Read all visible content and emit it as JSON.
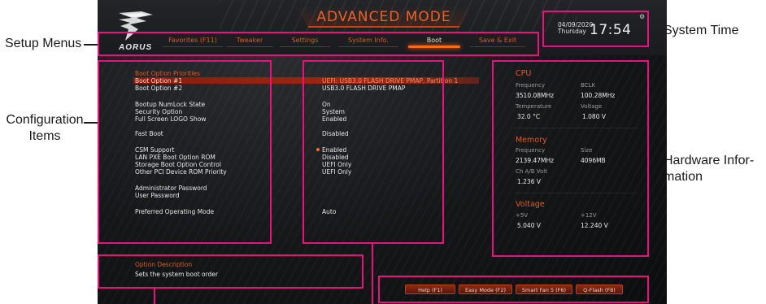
{
  "callouts": {
    "setup_menus": "Setup Menus",
    "configuration_items_line1": "Configuration",
    "configuration_items_line2": "Items",
    "system_time": "System Time",
    "hardware_info_line1": "Hardware Infor-",
    "hardware_info_line2": "mation"
  },
  "header": {
    "title": "ADVANCED MODE",
    "logo_text": "AORUS",
    "logo_icon": "eagle-logo-icon"
  },
  "clock": {
    "date": "04/09/2020",
    "day": "Thursday",
    "time": "17:54",
    "settings_icon": "gear-icon"
  },
  "tabs": [
    {
      "label": "Favorites (F11)",
      "active": false
    },
    {
      "label": "Tweaker",
      "active": false
    },
    {
      "label": "Settings",
      "active": false
    },
    {
      "label": "System Info.",
      "active": false
    },
    {
      "label": "Boot",
      "active": true
    },
    {
      "label": "Save & Exit",
      "active": false
    }
  ],
  "config": {
    "heading": "Boot Option Priorities",
    "items": [
      {
        "label": "Boot Option #1",
        "value": "UEFI: USB3.0 FLASH DRIVE PMAP, Partition 1"
      },
      {
        "label": "Boot Option #2",
        "value": "USB3.0 FLASH DRIVE PMAP"
      },
      {
        "label": "Bootup NumLock State",
        "value": "On"
      },
      {
        "label": "Security Option",
        "value": "System"
      },
      {
        "label": "Full Screen LOGO Show",
        "value": "Enabled"
      },
      {
        "label": "Fast Boot",
        "value": "Disabled"
      },
      {
        "label": "CSM Support",
        "value": "Enabled"
      },
      {
        "label": "LAN PXE Boot Option ROM",
        "value": "Disabled"
      },
      {
        "label": "Storage Boot Option Control",
        "value": "UEFI Only"
      },
      {
        "label": "Other PCI Device ROM Priority",
        "value": "UEFI Only"
      },
      {
        "label": "Administrator Password",
        "value": ""
      },
      {
        "label": "User Password",
        "value": ""
      },
      {
        "label": "Preferred Operating Mode",
        "value": "Auto"
      }
    ]
  },
  "description": {
    "title": "Option Description",
    "text": "Sets the system boot order"
  },
  "buttons": [
    {
      "label": "Help (F1)"
    },
    {
      "label": "Easy Mode (F2)"
    },
    {
      "label": "Smart Fan 5 (F6)"
    },
    {
      "label": "Q-Flash (F8)"
    }
  ],
  "hardware": {
    "cpu": {
      "title": "CPU",
      "frequency_label": "Frequency",
      "frequency": "3510.08MHz",
      "bclk_label": "BCLK",
      "bclk": "100.28MHz",
      "temperature_label": "Temperature",
      "temperature": "32.0 °C",
      "voltage_label": "Voltage",
      "voltage": "1.080 V"
    },
    "memory": {
      "title": "Memory",
      "frequency_label": "Frequency",
      "frequency": "2139.47MHz",
      "size_label": "Size",
      "size": "4096MB",
      "ch_volt_label": "Ch A/B Volt",
      "ch_volt": "1.236 V"
    },
    "voltage": {
      "title": "Voltage",
      "p5v_label": "+5V",
      "p5v": "5.040 V",
      "p12v_label": "+12V",
      "p12v": "12.240 V"
    }
  },
  "colors": {
    "accent": "#e25a22",
    "callout_border": "#e8127f",
    "selection": "#a32612"
  }
}
